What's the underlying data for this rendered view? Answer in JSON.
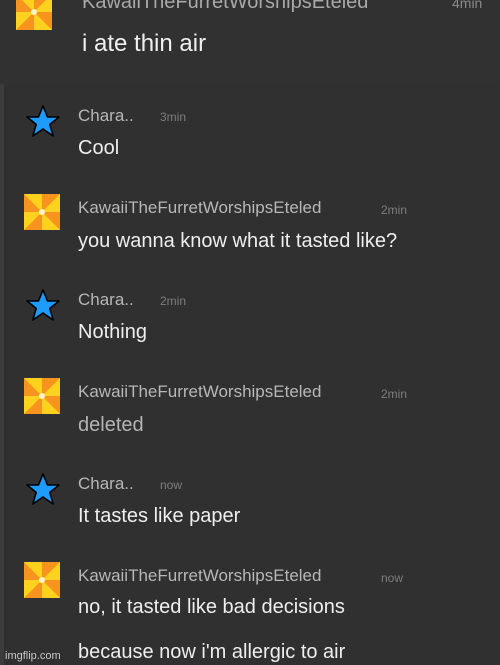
{
  "top_message": {
    "username": "KawaiiTheFurretWorshipsEteled",
    "time": "4min",
    "text": "i ate thin air",
    "avatar_icon": "pinwheel-icon"
  },
  "messages": [
    {
      "username": "Chara..",
      "time": "3min",
      "text": "Cool",
      "avatar_icon": "blue-star-icon"
    },
    {
      "username": "KawaiiTheFurretWorshipsEteled",
      "time": "2min",
      "text": "you wanna know what it tasted like?",
      "avatar_icon": "pinwheel-icon"
    },
    {
      "username": "Chara..",
      "time": "2min",
      "text": "Nothing",
      "avatar_icon": "blue-star-icon"
    },
    {
      "username": "KawaiiTheFurretWorshipsEteled",
      "time": "2min",
      "text": "deleted",
      "avatar_icon": "pinwheel-icon"
    },
    {
      "username": "Chara..",
      "time": "now",
      "text": "It tastes like paper",
      "avatar_icon": "blue-star-icon"
    },
    {
      "username": "KawaiiTheFurretWorshipsEteled",
      "time": "now",
      "text": "no, it tasted like bad decisions",
      "avatar_icon": "pinwheel-icon"
    }
  ],
  "continuation_text": "because now i'm allergic to air",
  "watermark": "imgflip.com",
  "colors": {
    "background": "#2e2e2e",
    "star_fill": "#1e9bff",
    "pinwheel_orange": "#f7941d",
    "pinwheel_yellow": "#ffd21f"
  }
}
